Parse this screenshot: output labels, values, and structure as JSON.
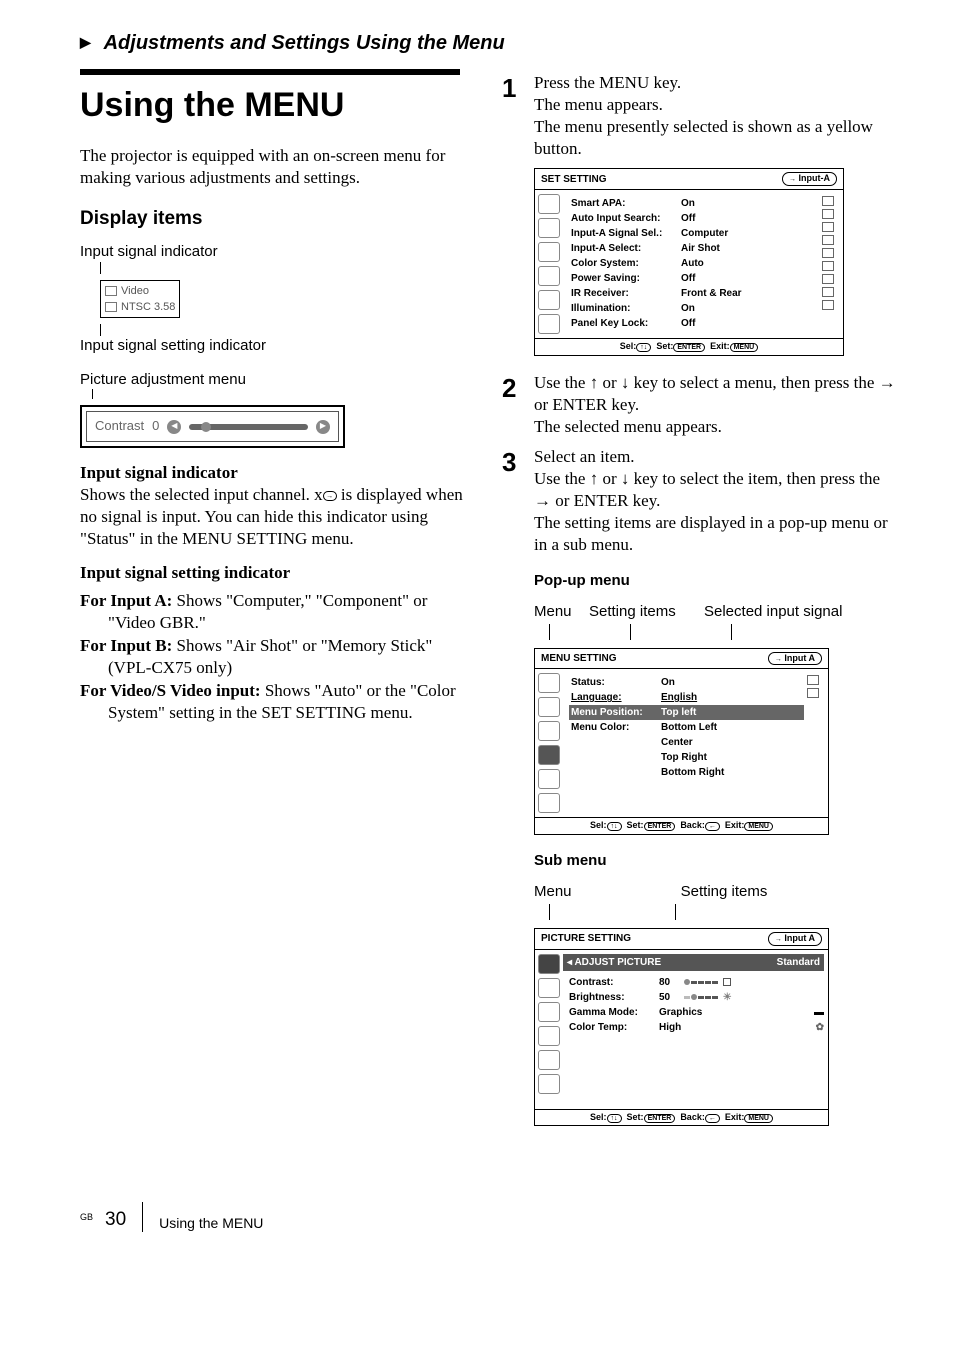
{
  "breadcrumb": "Adjustments and Settings Using the Menu",
  "title": "Using the MENU",
  "intro": "The projector is equipped with an on-screen menu for making various adjustments and settings.",
  "display_items_heading": "Display items",
  "input_signal_indicator_label": "Input signal indicator",
  "indicator_box": {
    "line1": "Video",
    "line2": "NTSC 3.58"
  },
  "input_signal_setting_indicator_label": "Input signal setting indicator",
  "picture_adjustment_menu_label": "Picture adjustment menu",
  "contrast_sample": {
    "label": "Contrast",
    "value": "0"
  },
  "input_signal_indicator_section": {
    "heading": "Input signal indicator",
    "body_part1": "Shows the selected input channel.  x",
    "body_part2": " is displayed when no signal is input. You can hide this indicator using \"Status\" in the MENU SETTING menu."
  },
  "input_signal_setting_section": {
    "heading": "Input signal setting indicator",
    "a_label": "For Input A:",
    "a_body": " Shows \"Computer,\" \"Component\" or \"Video GBR.\"",
    "b_label": "For Input B:",
    "b_body": " Shows \"Air Shot\" or \"Memory Stick\" (VPL-CX75 only)",
    "v_label": "For Video/S Video input:",
    "v_body": " Shows \"Auto\" or the \"Color System\" setting in the SET SETTING menu."
  },
  "steps": {
    "s1": {
      "line1": "Press the MENU key.",
      "line2": "The menu appears.",
      "line3": "The menu presently selected is shown as a yellow button."
    },
    "s2": {
      "line1a": "Use the ",
      "line1b": " or ",
      "line1c": " key to select a menu, then press the ",
      "line1d": " or ENTER key.",
      "line2": "The selected menu appears."
    },
    "s3": {
      "line1": "Select an item.",
      "line2a": "Use the ",
      "line2b": " or ",
      "line2c": " key to select the item, then press the ",
      "line2d": " or ENTER key.",
      "line3": "The setting items are displayed in a pop-up menu or in a sub menu."
    }
  },
  "popup_menu_label": "Pop-up menu",
  "selected_input_signal_label": "Selected input signal",
  "menu_label": "Menu",
  "setting_items_label": "Setting items",
  "sub_menu_label": "Sub menu",
  "set_setting_osd": {
    "title": "SET SETTING",
    "input": "Input-A",
    "rows": [
      {
        "label": "Smart APA:",
        "value": "On"
      },
      {
        "label": "Auto Input Search:",
        "value": "Off"
      },
      {
        "label": "Input-A Signal Sel.:",
        "value": "Computer"
      },
      {
        "label": "Input-A Select:",
        "value": "Air Shot"
      },
      {
        "label": "Color System:",
        "value": "Auto"
      },
      {
        "label": "Power Saving:",
        "value": "Off"
      },
      {
        "label": "IR Receiver:",
        "value": "Front & Rear"
      },
      {
        "label": "Illumination:",
        "value": "On"
      },
      {
        "label": "Panel Key Lock:",
        "value": "Off"
      }
    ],
    "footer": {
      "sel": "Sel:",
      "set": "Set:",
      "exit": "Exit:",
      "enter_key": "ENTER",
      "menu_key": "MENU",
      "arrows": "↑↓"
    }
  },
  "menu_setting_osd": {
    "title": "MENU SETTING",
    "input": "Input A",
    "rows": [
      {
        "label": "Status:",
        "value": "On"
      },
      {
        "label": "Language:",
        "value": "English"
      }
    ],
    "highlight_row": {
      "label": "Menu Position:",
      "value": "Top left"
    },
    "after_rows": [
      {
        "label": "Menu Color:",
        "value": "Bottom Left"
      }
    ],
    "extra_values": [
      "Center",
      "Top Right",
      "Bottom Right"
    ],
    "footer": {
      "back": "Back:"
    }
  },
  "picture_setting_osd": {
    "title": "PICTURE SETTING",
    "input": "Input A",
    "sub_header_left": "ADJUST PICTURE",
    "sub_header_right": "Standard",
    "rows": [
      {
        "label": "Contrast:",
        "value": "80"
      },
      {
        "label": "Brightness:",
        "value": "50"
      },
      {
        "label": "Gamma Mode:",
        "value": "Graphics"
      },
      {
        "label": "Color Temp:",
        "value": "High"
      }
    ]
  },
  "footer": {
    "gb": "GB",
    "page": "30",
    "caption": "Using the MENU"
  }
}
